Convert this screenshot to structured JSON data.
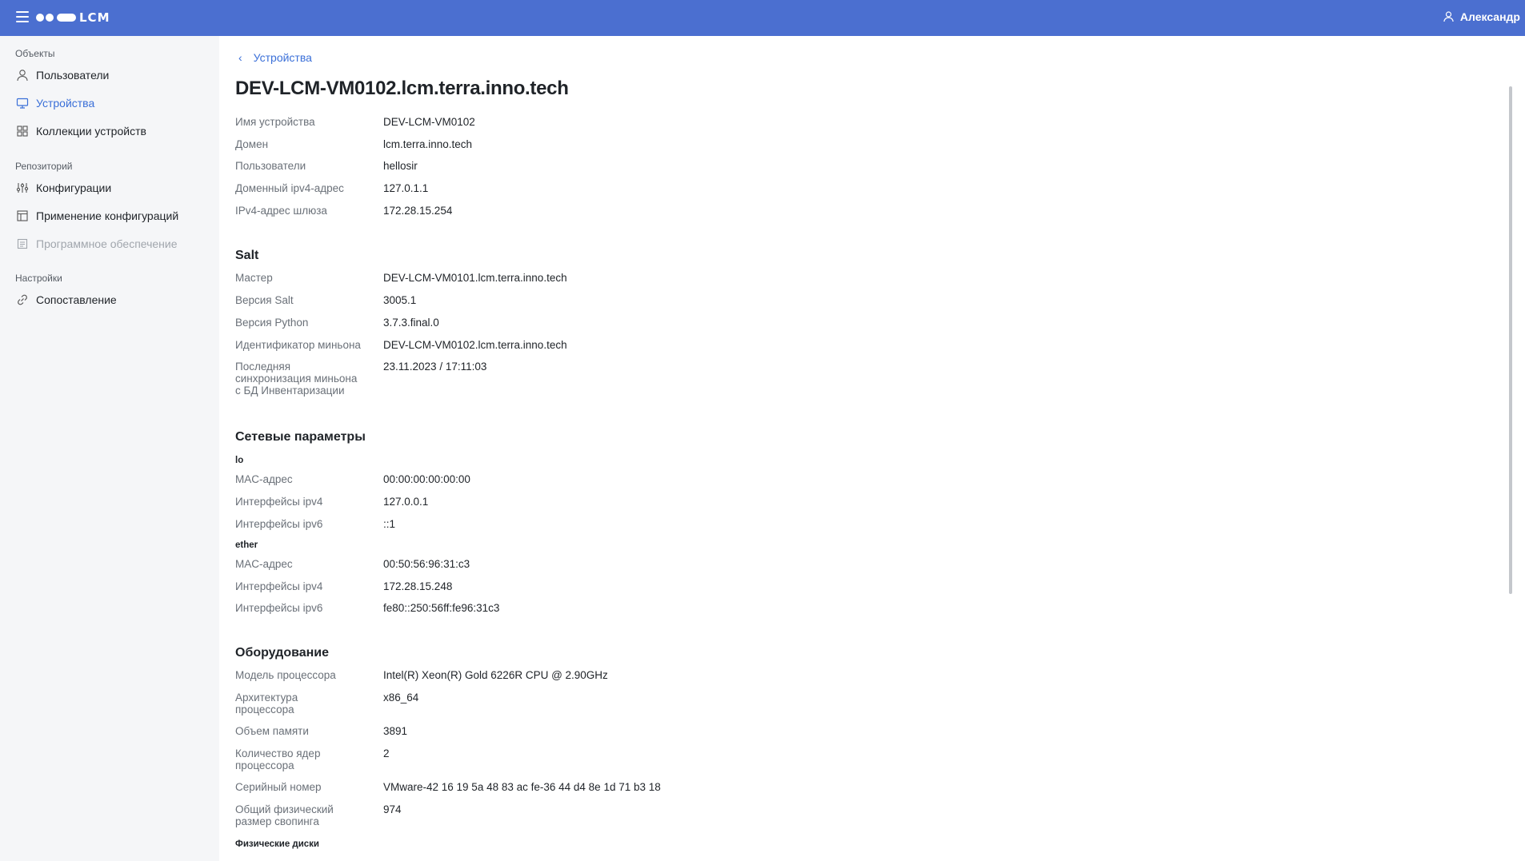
{
  "header": {
    "logo_text": "LCM",
    "user_name": "Александр"
  },
  "sidebar": {
    "groups": [
      {
        "label": "Объекты"
      },
      {
        "label": "Репозиторий"
      },
      {
        "label": "Настройки"
      }
    ],
    "items": [
      {
        "label": "Пользователи"
      },
      {
        "label": "Устройства"
      },
      {
        "label": "Коллекции устройств"
      },
      {
        "label": "Конфигурации"
      },
      {
        "label": "Применение конфигураций"
      },
      {
        "label": "Программное обеспечение"
      },
      {
        "label": "Сопоставление"
      }
    ]
  },
  "main": {
    "breadcrumb": "Устройства",
    "title": "DEV-LCM-VM0102.lcm.terra.inno.tech",
    "general": [
      {
        "label": "Имя устройства",
        "value": "DEV-LCM-VM0102"
      },
      {
        "label": "Домен",
        "value": "lcm.terra.inno.tech"
      },
      {
        "label": "Пользователи",
        "value": "hellosir"
      },
      {
        "label": "Доменный ipv4-адрес",
        "value": "127.0.1.1"
      },
      {
        "label": "IPv4-адрес шлюза",
        "value": "172.28.15.254"
      }
    ],
    "salt": {
      "title": "Salt",
      "rows": [
        {
          "label": "Мастер",
          "value": "DEV-LCM-VM0101.lcm.terra.inno.tech"
        },
        {
          "label": "Версия Salt",
          "value": "3005.1"
        },
        {
          "label": "Версия Python",
          "value": "3.7.3.final.0"
        },
        {
          "label": "Идентификатор миньона",
          "value": "DEV-LCM-VM0102.lcm.terra.inno.tech"
        },
        {
          "label_lines": [
            "Последняя",
            "синхронизация миньона",
            "с БД Инвентаризации"
          ],
          "value": "23.11.2023 / 17:11:03"
        }
      ]
    },
    "network": {
      "title": "Сетевые параметры",
      "interfaces": [
        {
          "name": "lo",
          "rows": [
            {
              "label": "MAC-адрес",
              "value": "00:00:00:00:00:00"
            },
            {
              "label": "Интерфейсы ipv4",
              "value": "127.0.0.1"
            },
            {
              "label": "Интерфейсы ipv6",
              "value": "::1"
            }
          ]
        },
        {
          "name": "ether",
          "rows": [
            {
              "label": "MAC-адрес",
              "value": "00:50:56:96:31:c3"
            },
            {
              "label": "Интерфейсы ipv4",
              "value": "172.28.15.248"
            },
            {
              "label": "Интерфейсы ipv6",
              "value": "fe80::250:56ff:fe96:31c3"
            }
          ]
        }
      ]
    },
    "hardware": {
      "title": "Оборудование",
      "rows": [
        {
          "label_lines": [
            "Модель процессора"
          ],
          "value": "Intel(R) Xeon(R) Gold 6226R CPU @ 2.90GHz"
        },
        {
          "label_lines": [
            "Архитектура",
            "процессора"
          ],
          "value": "x86_64"
        },
        {
          "label_lines": [
            "Объем памяти"
          ],
          "value": "3891"
        },
        {
          "label_lines": [
            "Количество ядер",
            "процессора"
          ],
          "value": "2"
        },
        {
          "label_lines": [
            "Серийный номер"
          ],
          "value": "VMware-42 16 19 5a 48 83 ac fe-36 44 d4 8e 1d 71 b3 18"
        },
        {
          "label_lines": [
            "Общий физический",
            "размер свопинга"
          ],
          "value": "974"
        }
      ],
      "subhead": "Физические диски"
    }
  },
  "colors": {
    "header_bg": "#4b6fd0",
    "sidebar_bg": "#f5f6f8",
    "accent": "#3a6fd8",
    "label": "#6a7078",
    "disabled": "#a1a6ad"
  }
}
